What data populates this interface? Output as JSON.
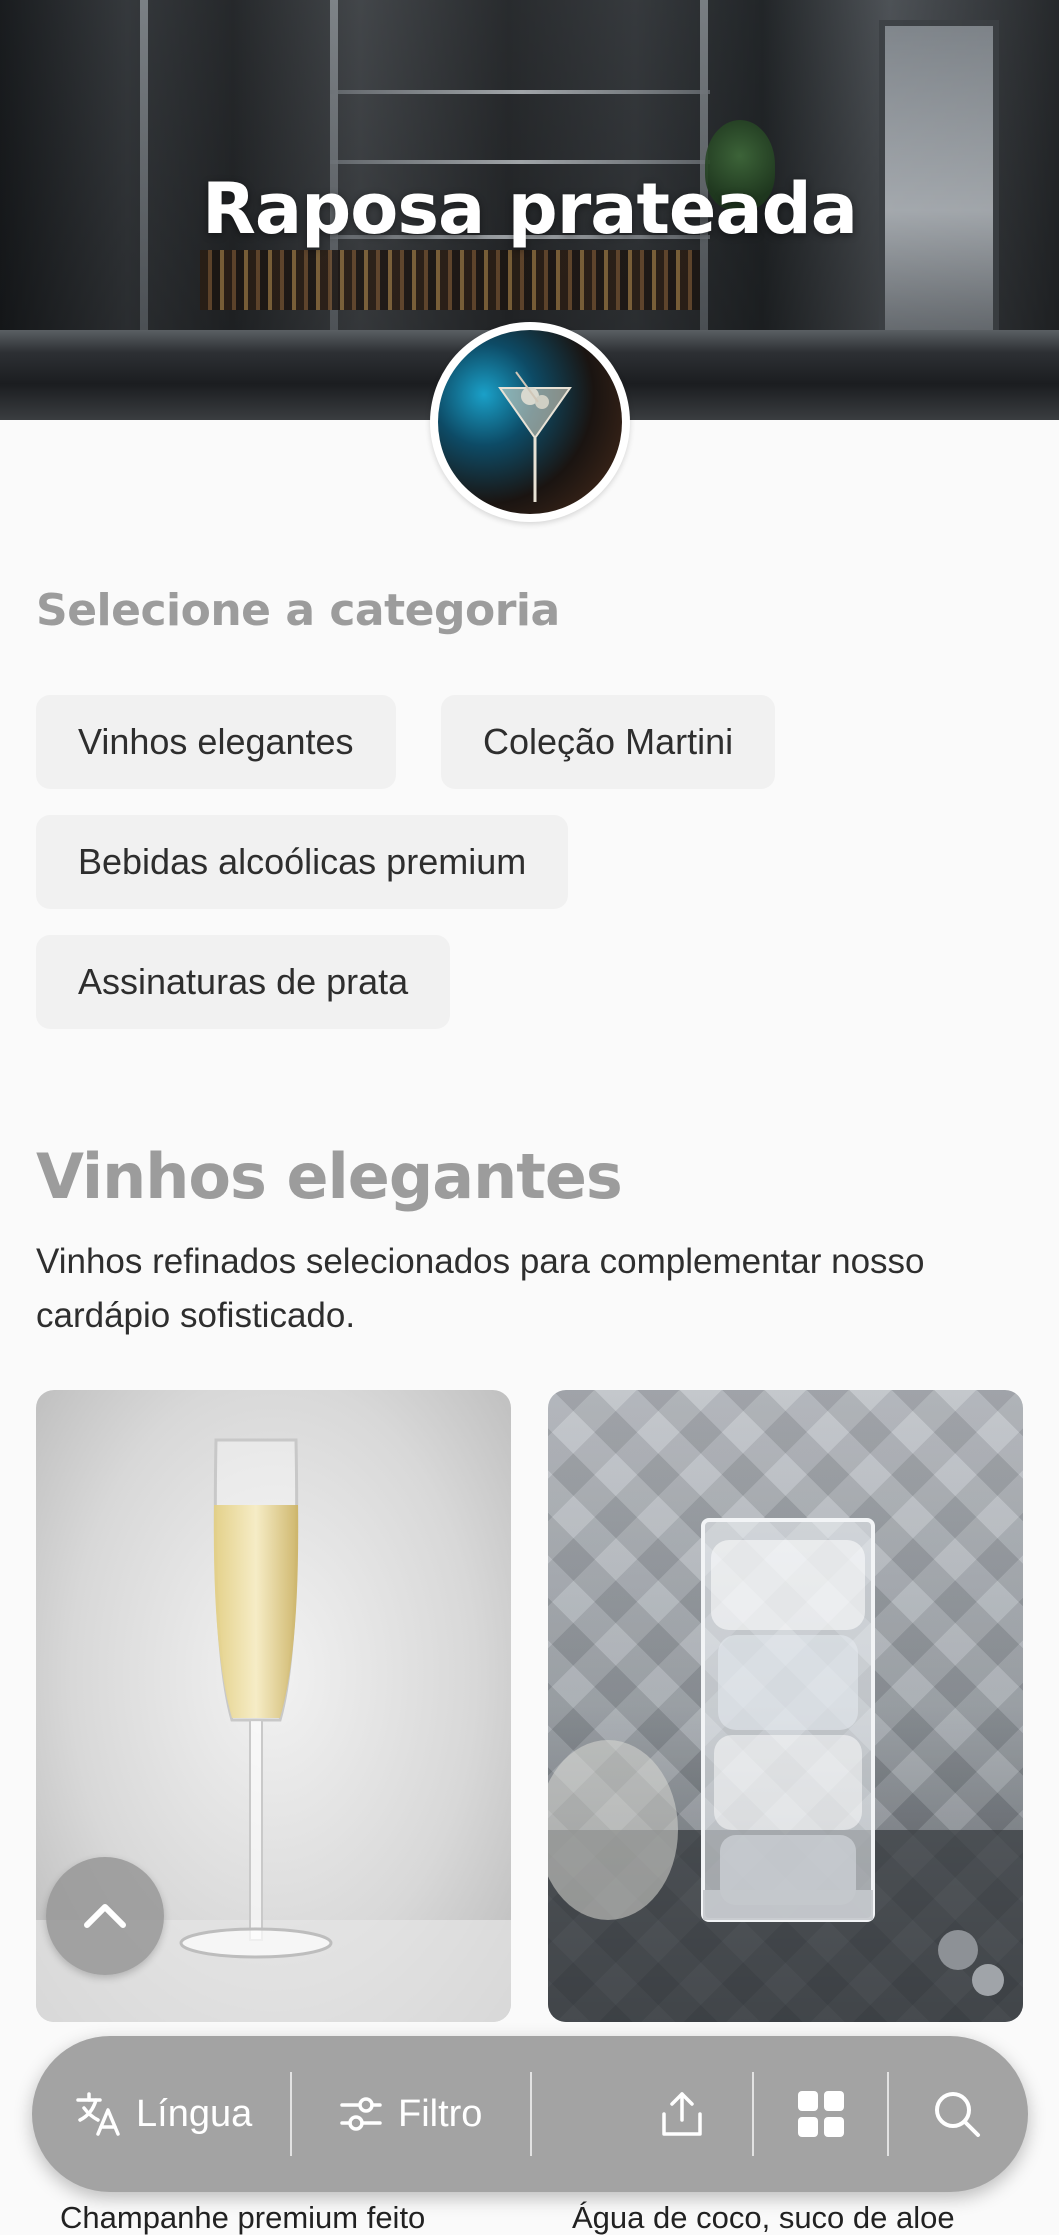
{
  "hero": {
    "title": "Raposa prateada"
  },
  "category": {
    "heading": "Selecione a categoria",
    "chips": [
      "Vinhos elegantes",
      "Coleção Martini",
      "Bebidas alcoólicas premium",
      "Assinaturas de prata"
    ]
  },
  "section": {
    "title": "Vinhos elegantes",
    "description": "Vinhos refinados selecionados para complementar nosso cardápio sofisticado.",
    "items": [
      {
        "caption": "Champanhe premium feito",
        "image": "champagne-flute"
      },
      {
        "caption": "Água de coco, suco de aloe",
        "image": "ice-glass"
      }
    ]
  },
  "toolbar": {
    "language_label": "Língua",
    "filter_label": "Filtro",
    "icons": [
      "translate-icon",
      "sliders-icon",
      "share-icon",
      "grid-icon",
      "search-icon"
    ]
  },
  "floating": {
    "scroll_top_icon": "chevron-up-icon"
  }
}
